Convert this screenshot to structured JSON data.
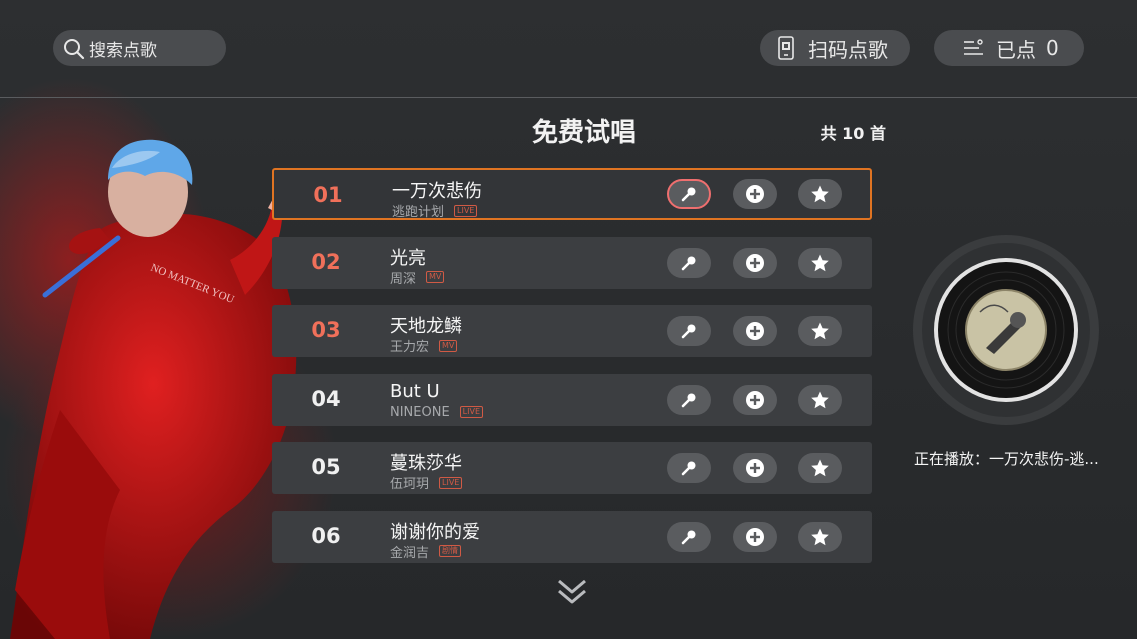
{
  "header": {
    "search_label": "搜索点歌",
    "scan_label": "扫码点歌",
    "queue_label": "已点",
    "queue_count": "0"
  },
  "list": {
    "title": "免费试唱",
    "total": "共 10 首",
    "songs": [
      {
        "no": "01",
        "name": "一万次悲伤",
        "artist": "逃跑计划",
        "tag": "LIVE",
        "hot": true,
        "focused": true
      },
      {
        "no": "02",
        "name": "光亮",
        "artist": "周深",
        "tag": "MV",
        "hot": true
      },
      {
        "no": "03",
        "name": "天地龙鳞",
        "artist": "王力宏",
        "tag": "MV",
        "hot": true
      },
      {
        "no": "04",
        "name": "But U",
        "artist": "NINEONE",
        "tag": "LIVE",
        "hot": false
      },
      {
        "no": "05",
        "name": "蔓珠莎华",
        "artist": "伍珂玥",
        "tag": "LIVE",
        "hot": false
      },
      {
        "no": "06",
        "name": "谢谢你的爱",
        "artist": "金润吉",
        "tag": "剧情",
        "hot": false
      }
    ]
  },
  "player": {
    "now_playing": "正在播放：一万次悲伤-逃..."
  },
  "colors": {
    "focus_border": "#e07422",
    "hot_number": "#f0705a",
    "tag": "#d05a45"
  },
  "icons": [
    "search-icon",
    "phone-qr-icon",
    "queue-list-icon",
    "mic-icon",
    "plus-circle-icon",
    "star-icon",
    "double-chevron-down-icon",
    "vinyl-disc-icon"
  ]
}
